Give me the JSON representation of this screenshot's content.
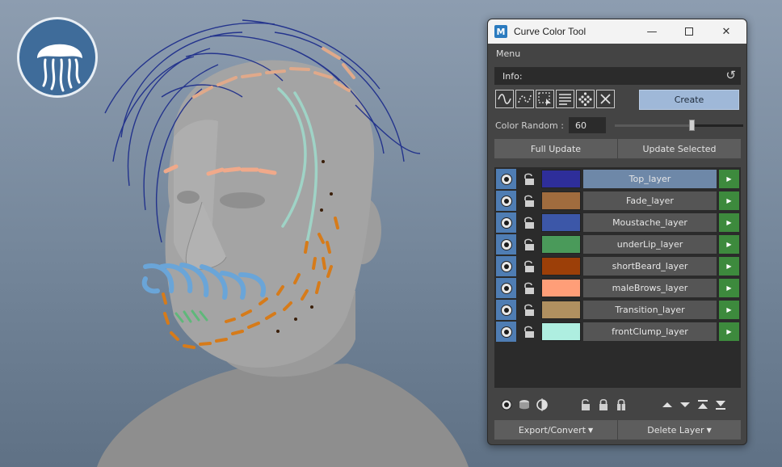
{
  "window": {
    "title": "Curve Color Tool",
    "app_icon_letter": "M",
    "controls": {
      "minimize": "—",
      "close": "✕"
    }
  },
  "menubar": {
    "menu_label": "Menu"
  },
  "info": {
    "label": "Info:",
    "reset_icon": "refresh-icon"
  },
  "toolbar": {
    "tool_icons": [
      "wave-curve-icon",
      "dotted-curve-icon",
      "select-box-icon",
      "align-lines-icon",
      "dots-cluster-icon",
      "cross-icon"
    ],
    "create_label": "Create"
  },
  "color_random": {
    "label": "Color Random :",
    "value": "60",
    "slider_fraction": 0.6
  },
  "update": {
    "full_label": "Full Update",
    "selected_label": "Update Selected"
  },
  "layers": [
    {
      "name": "Top_layer",
      "color": "#2e2e9a",
      "selected": true
    },
    {
      "name": "Fade_layer",
      "color": "#a06c3e",
      "selected": false
    },
    {
      "name": "Moustache_layer",
      "color": "#3c57a8",
      "selected": false
    },
    {
      "name": "underLip_layer",
      "color": "#4a9a5a",
      "selected": false
    },
    {
      "name": "shortBeard_layer",
      "color": "#9c3f08",
      "selected": false
    },
    {
      "name": "maleBrows_layer",
      "color": "#ff9e78",
      "selected": false
    },
    {
      "name": "Transition_layer",
      "color": "#b09060",
      "selected": false
    },
    {
      "name": "frontClump_layer",
      "color": "#aeeee0",
      "selected": false
    }
  ],
  "layer_row_icons": {
    "visibility": "eye-icon",
    "lock": "unlock-icon",
    "expand": "play-arrow-icon"
  },
  "bottom_icons": [
    "eye-icon",
    "stack-icon",
    "half-circle-icon",
    "unlock-icon",
    "lock-icon",
    "lock-split-icon",
    "move-up-icon",
    "move-down-icon",
    "move-top-icon",
    "move-bottom-icon"
  ],
  "bottom_actions": {
    "export_label": "Export/Convert",
    "delete_label": "Delete Layer"
  },
  "colors": {
    "window_bg": "#444444",
    "create_button": "#9fb8d8",
    "selected_layer": "#6e88a8",
    "expand_green": "#3d8a3d",
    "eye_blue": "#4f7db3"
  }
}
